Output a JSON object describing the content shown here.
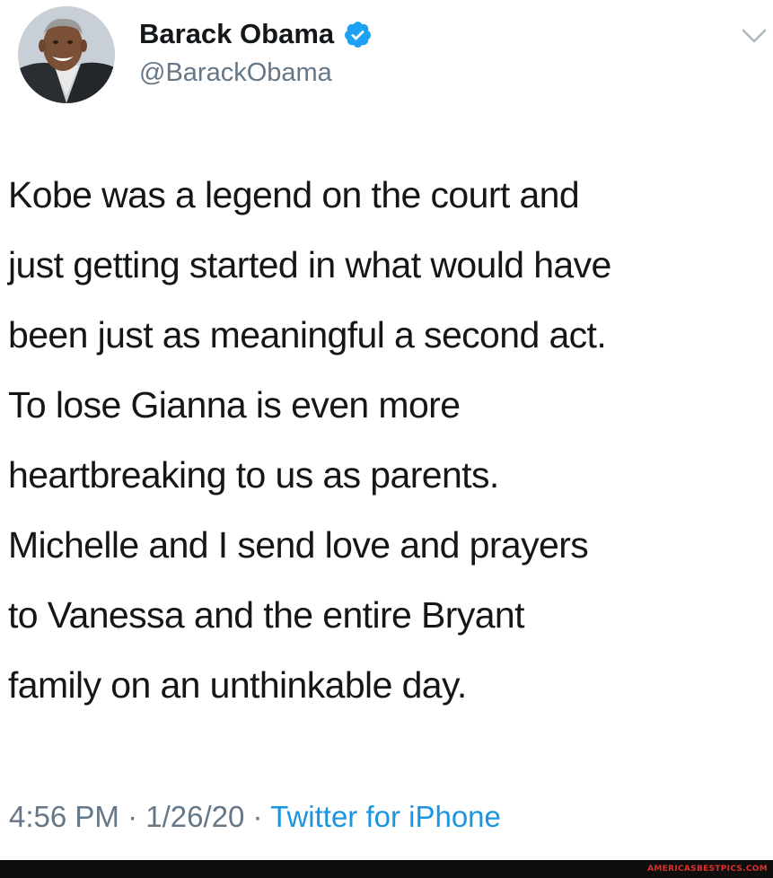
{
  "user": {
    "display_name": "Barack Obama",
    "handle": "@BarackObama",
    "verified": true,
    "avatar_icon": "profile-photo",
    "verified_icon": "verified-badge-icon"
  },
  "menu": {
    "icon": "chevron-down-icon"
  },
  "tweet": {
    "lines": [
      "Kobe was a legend on the court and",
      "just getting started in what would have",
      "been just as meaningful a second act.",
      "To lose Gianna is even more",
      "heartbreaking to us as parents.",
      "Michelle and I send love and prayers",
      "to Vanessa and the entire Bryant",
      "family on an unthinkable day."
    ]
  },
  "meta": {
    "time": "4:56 PM",
    "separator": "·",
    "date": "1/26/20",
    "source": "Twitter for iPhone"
  },
  "watermark": {
    "text": "AMERICASBESTPICS.COM"
  },
  "colors": {
    "text": "#14171a",
    "secondary": "#657786",
    "link": "#1b95e0",
    "verified": "#1da1f2",
    "watermark": "#e0302a"
  }
}
